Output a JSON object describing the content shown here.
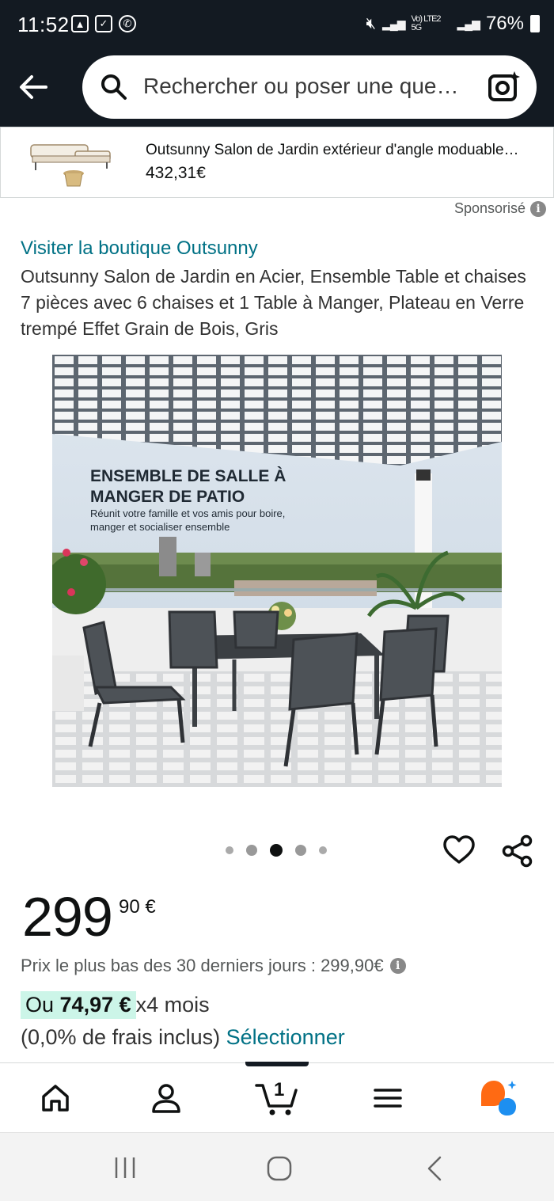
{
  "status_bar": {
    "time": "11:52",
    "network": "Vo) LTE2 5G",
    "battery": "76%"
  },
  "search": {
    "placeholder": "Rechercher ou poser une que…"
  },
  "sponsored_ad": {
    "title": "Outsunny Salon de Jardin extérieur d'angle moduable…",
    "price": "432,31€"
  },
  "sponsor_label": "Sponsorisé",
  "product": {
    "store_link": "Visiter la boutique Outsunny",
    "title": "Outsunny Salon de Jardin en Acier, Ensemble Table et chaises 7 pièces avec 6 chaises et 1 Table à Manger, Plateau en Verre trempé Effet Grain de Bois, Gris",
    "image_heading_line1": "ENSEMBLE DE SALLE À",
    "image_heading_line2": "MANGER DE PATIO",
    "image_sub_line1": "Réunit votre famille et vos amis pour boire,",
    "image_sub_line2": "manger et socialiser ensemble",
    "carousel_total": 5,
    "carousel_active": 3
  },
  "pricing": {
    "price_whole": "299",
    "price_fraction": "90 €",
    "lowest_30_days": "Prix le plus bas des 30 derniers jours : 299,90€",
    "installment_prefix": "Ou ",
    "installment_amount": "74,97 €",
    "installment_suffix": " x4 mois",
    "fees_text": "(0,0% de frais inclus) ",
    "select_label": "Sélectionner"
  },
  "bottom_tabs": {
    "cart_count": "1"
  },
  "colors": {
    "header_bg": "#131a22",
    "link": "#007185",
    "installment_highlight": "#ccf5e8",
    "rufus_orange": "#ff6a13",
    "rufus_blue": "#1d8ff0"
  }
}
